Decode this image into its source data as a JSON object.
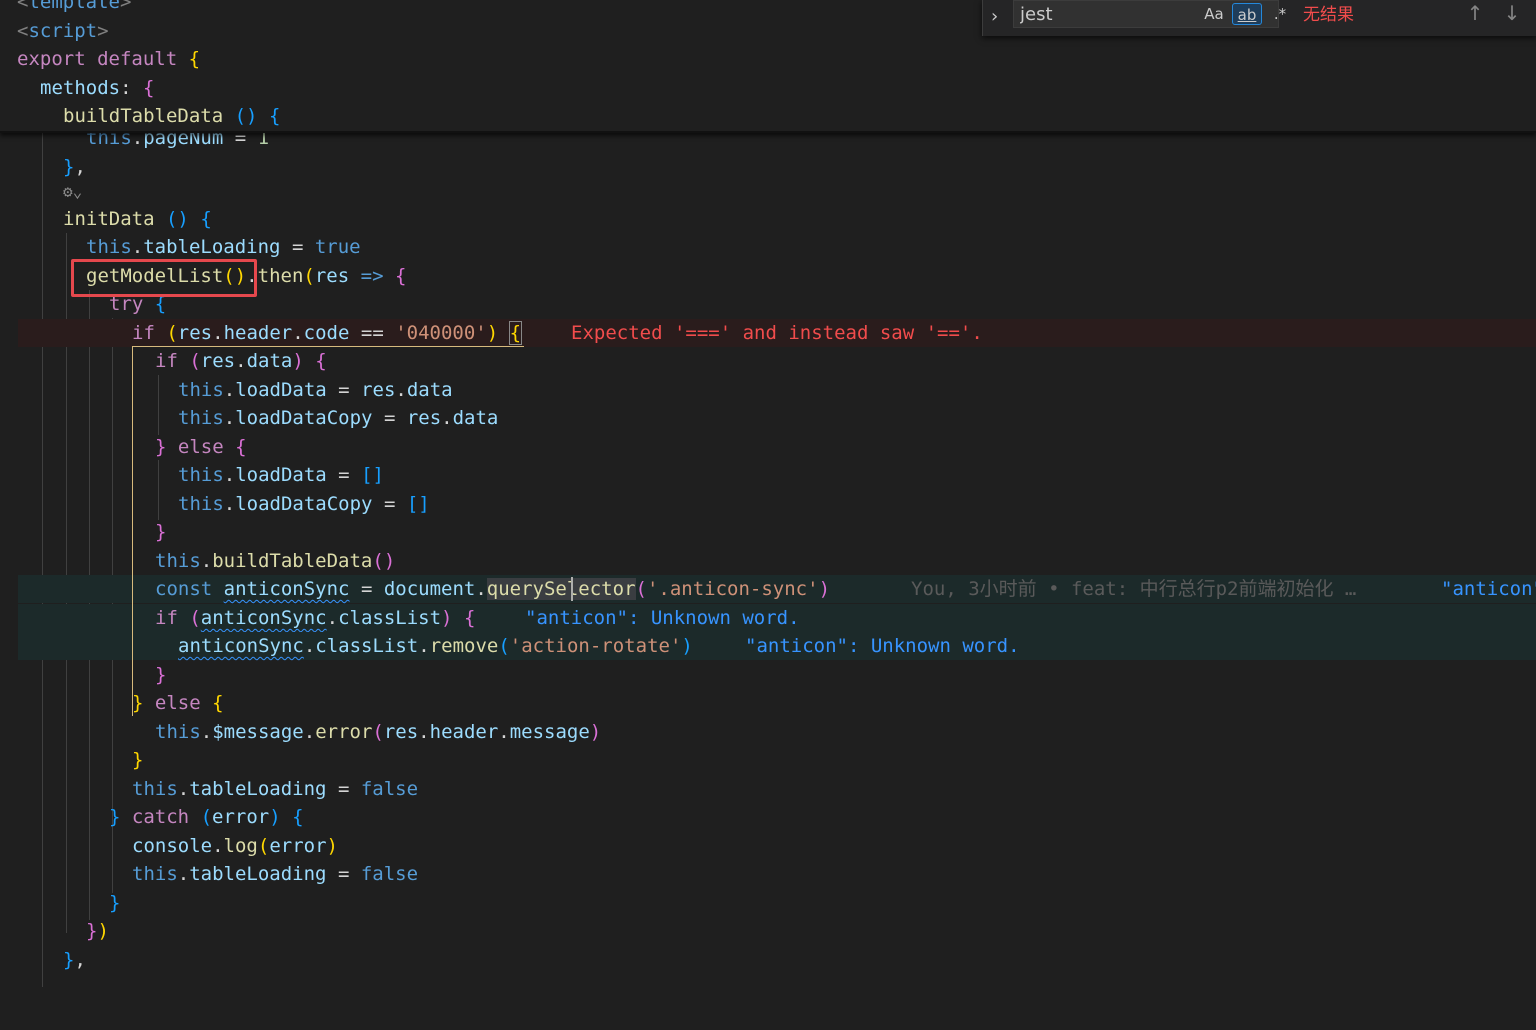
{
  "find": {
    "query": "jest",
    "match_case": "Aa",
    "whole_word": "ab",
    "regex": ".*",
    "status": "无结果",
    "prev_icon": "arrow-up",
    "next_icon": "arrow-down"
  },
  "sticky": {
    "l1": "template",
    "l2": "script",
    "l3a": "export",
    "l3b": "default",
    "l4": "methods",
    "l5": "buildTableData"
  },
  "code": {
    "this": "this",
    "pageNum": "pageNum",
    "one": "1",
    "initData": "initData",
    "tableLoading": "tableLoading",
    "true": "true",
    "false": "false",
    "getModelList": "getModelList",
    "then": "then",
    "res": "res",
    "try": "try",
    "if": "if",
    "else": "else",
    "header": "header",
    "code": "code",
    "codeValue": "'040000'",
    "data": "data",
    "loadData": "loadData",
    "loadDataCopy": "loadDataCopy",
    "buildTableData": "buildTableData",
    "const": "const",
    "anticonSync": "anticonSync",
    "document": "document",
    "querySelector": "querySelector",
    "selectorArg": "'.anticon-sync'",
    "classList": "classList",
    "remove": "remove",
    "removeArg": "'action-rotate'",
    "message": "$message",
    "error": "error",
    "messageProp": "message",
    "catch": "catch",
    "console": "console",
    "log": "log"
  },
  "diagnostics": {
    "eqeq": "Expected '===' and instead saw '=='.",
    "anticon1": "\"anticon\": Unknown word.",
    "anticon2": "\"anticon\": Unknown word.",
    "anticon_truncated": "\"anticon\""
  },
  "blame": "You, 3小时前 • feat: 中行总行p2前端初始化 …",
  "colors": {
    "error": "#f14c4c",
    "info": "#3794ff",
    "highlight_box": "#e5484d"
  }
}
